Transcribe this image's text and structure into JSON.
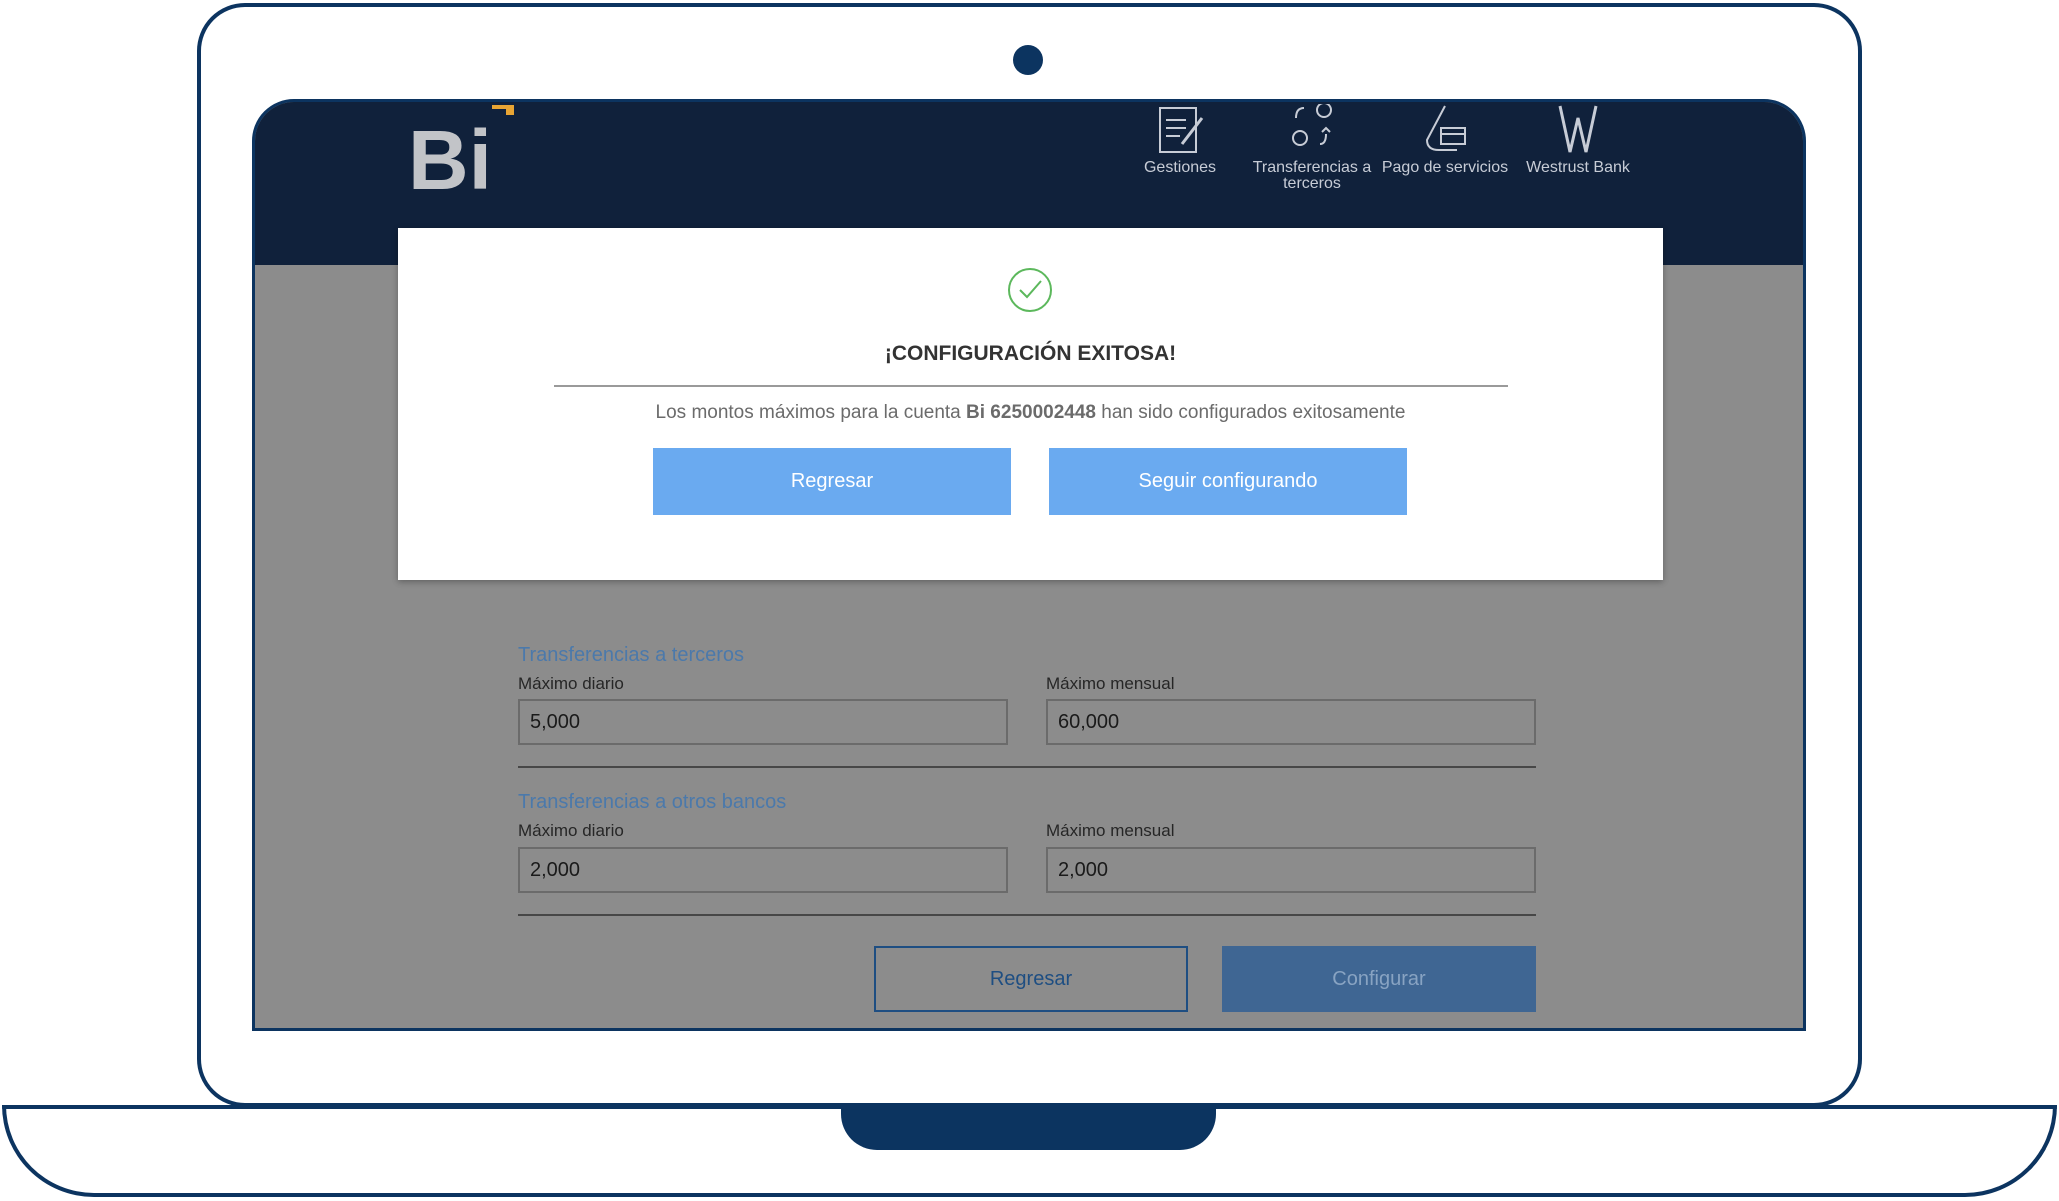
{
  "header": {
    "logo_text": "Bi",
    "nav": [
      {
        "label": "Gestiones",
        "icon": "document-edit-icon"
      },
      {
        "label": "Transferencias a terceros",
        "icon": "transfer-icon"
      },
      {
        "label": "Pago de servicios",
        "icon": "service-payment-icon"
      },
      {
        "label": "Westrust Bank",
        "icon": "westrust-logo-icon"
      }
    ]
  },
  "form": {
    "section1": {
      "title": "Transferencias a terceros",
      "daily_label": "Máximo diario",
      "daily_value": "5,000",
      "monthly_label": "Máximo mensual",
      "monthly_value": "60,000"
    },
    "section2": {
      "title": "Transferencias a otros bancos",
      "daily_label": "Máximo diario",
      "daily_value": "2,000",
      "monthly_label": "Máximo mensual",
      "monthly_value": "2,000"
    },
    "back_label": "Regresar",
    "configure_label": "Configurar"
  },
  "modal": {
    "icon": "check-circle-icon",
    "title": "¡CONFIGURACIÓN EXITOSA!",
    "message_prefix": "Los montos máximos para la cuenta",
    "account": "Bi 6250002448",
    "message_suffix": "han sido configurados exitosamente",
    "back_label": "Regresar",
    "continue_label": "Seguir configurando"
  },
  "colors": {
    "frame": "#0c3460",
    "header": "#10213b",
    "modal_button": "#6aaaf0",
    "success": "#5cb85c"
  }
}
